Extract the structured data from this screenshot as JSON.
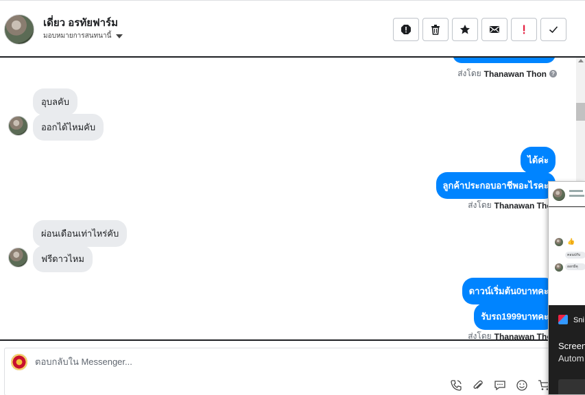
{
  "header": {
    "contact_name": "เดี่ยว อรทัยฟาร์ม",
    "assign_label": "มอบหมายการสนทนานี้",
    "actions": [
      {
        "name": "spam-icon",
        "label": "spam"
      },
      {
        "name": "trash-icon",
        "label": "delete"
      },
      {
        "name": "star-icon",
        "label": "star"
      },
      {
        "name": "envelope-icon",
        "label": "mark unread"
      },
      {
        "name": "exclamation-icon",
        "label": "follow up"
      },
      {
        "name": "checkmark-icon",
        "label": "done"
      }
    ]
  },
  "messages": {
    "sent_by_prefix": "ส่งโดย",
    "sender_name": "Thanawan Thon",
    "in_1": "อุบลคับ",
    "in_2": "ออกได้ไหมคับ",
    "out_1": "ได้ค่ะ",
    "out_2": "ลูกค้าประกอบอาชีพอะไรคะ",
    "in_3": "ผ่อนเดือนเท่าไหร่คับ",
    "in_4": "ฟรีดาวไหม",
    "out_3": "ดาวน์เริ่มต้น0บาทคะ",
    "out_4": "รับรถ1999บาทคะ"
  },
  "composer": {
    "placeholder": "ตอบกลับใน Messenger...",
    "tools": [
      "phone-icon",
      "paperclip-icon",
      "chat-bubble-icon",
      "emoji-icon",
      "cart-icon"
    ]
  },
  "overlay": {
    "toast_title": "Sni",
    "toast_line1": "Screen",
    "toast_line2": "Autom",
    "mini_bubble_1": "คอนปกับ",
    "mini_bubble_2": "ออกมีคุ"
  },
  "colors": {
    "accent": "#0084ff",
    "incoming_bubble": "#e9ebee",
    "toast_bg": "#1f1f1f",
    "followup_red": "#e41e3f"
  }
}
